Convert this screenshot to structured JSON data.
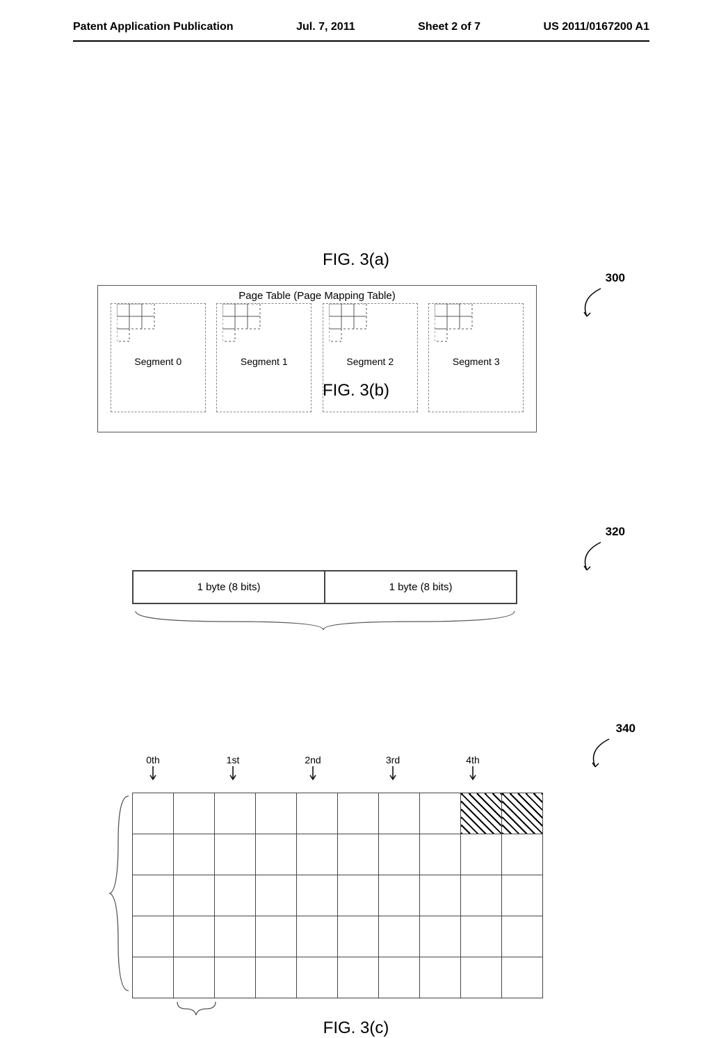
{
  "header": {
    "left": "Patent Application Publication",
    "mid": "Jul. 7, 2011",
    "sheet": "Sheet 2 of 7",
    "right": "US 2011/0167200 A1"
  },
  "fig_a": {
    "ref": "300",
    "title": "Page Table (Page Mapping Table)",
    "segments": [
      "Segment 0",
      "Segment 1",
      "Segment 2",
      "Segment 3"
    ],
    "caption": "FIG. 3(a)"
  },
  "fig_b": {
    "ref": "320",
    "cells": [
      "1 byte (8 bits)",
      "1 byte (8 bits)"
    ],
    "caption": "FIG. 3(b)"
  },
  "fig_c": {
    "ref": "340",
    "ordinals": [
      "0th",
      "1st",
      "2nd",
      "3rd",
      "4th"
    ],
    "caption": "FIG. 3(c)"
  },
  "chart_data": [
    {
      "type": "table",
      "title": "Page Table (Page Mapping Table) segments",
      "segments": [
        "Segment 0",
        "Segment 1",
        "Segment 2",
        "Segment 3"
      ],
      "segment_grid_implied": "3x3 cells each (partial/dashed)"
    },
    {
      "type": "table",
      "title": "Entry layout",
      "cells": [
        "1 byte (8 bits)",
        "1 byte (8 bits)"
      ],
      "total_bits": 16
    },
    {
      "type": "table",
      "title": "Grid 340",
      "columns": 10,
      "rows": 5,
      "column_group_labels": [
        "0th",
        "1st",
        "2nd",
        "3rd",
        "4th"
      ],
      "columns_per_group": 2,
      "shaded_cells": [
        [
          0,
          8
        ],
        [
          0,
          9
        ]
      ],
      "note": "row/col indices zero-based; top-right two cells hatched"
    }
  ]
}
